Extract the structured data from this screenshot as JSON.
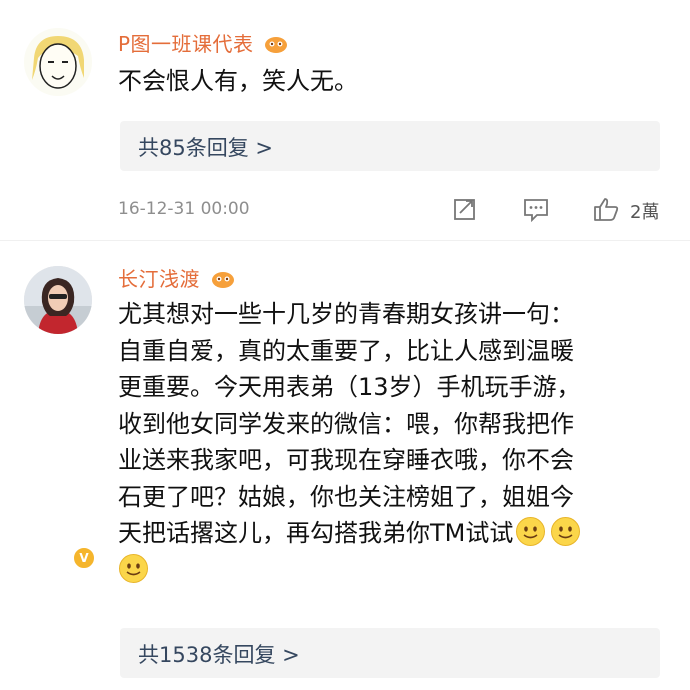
{
  "comments": [
    {
      "username": "P图一班课代表",
      "text": "不会恨人有，笑人无。",
      "reply_link": "共85条回复 >",
      "timestamp": "16-12-31 00:00",
      "likes": "2萬",
      "icons": {
        "avatar": "cartoon-face-avatar",
        "share": "share-icon",
        "comment": "comment-icon",
        "like": "thumbs-up-icon",
        "medal": "fan-medal-icon"
      }
    },
    {
      "username": "长汀浅渡",
      "text_lines": [
        "尤其想对一些十几岁的青春期女孩讲一句：",
        "自重自爱，真的太重要了，比让人感到温暖",
        "更重要。今天用表弟（13岁）手机玩手游，",
        "收到他女同学发来的微信：喂，你帮我把作",
        "业送来我家吧，可我现在穿睡衣哦，你不会",
        "石更了吧？姑娘，你也关注榜姐了，姐姐今",
        "天把话撂这儿，再勾搭我弟你TM试试"
      ],
      "reply_link": "共1538条回复 >",
      "icons": {
        "avatar": "woman-photo-avatar",
        "badge": "verified-badge-icon",
        "medal": "fan-medal-icon",
        "emoji": "smile-emoji-icon"
      }
    }
  ],
  "colors": {
    "username": "#e46d3a",
    "reply_link": "#35475f",
    "reply_bg": "#f3f3f3",
    "meta": "#8e8e8e"
  }
}
